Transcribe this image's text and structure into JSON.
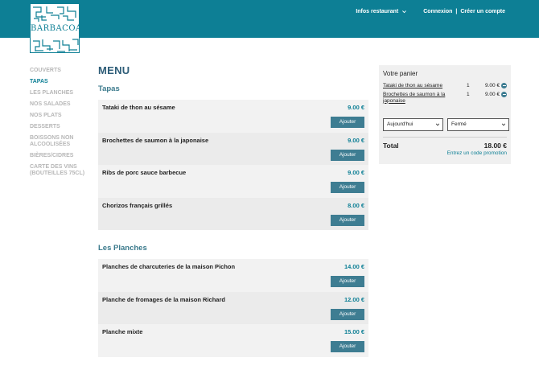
{
  "header": {
    "logo_text": "BARBACOA",
    "nav_info": "Infos restaurant",
    "login": "Connexion",
    "separator": "|",
    "signup": "Créer un compte"
  },
  "sidebar": {
    "items": [
      {
        "label": "COUVERTS",
        "active": false
      },
      {
        "label": "TAPAS",
        "active": true
      },
      {
        "label": "LES PLANCHES",
        "active": false
      },
      {
        "label": "NOS SALADES",
        "active": false
      },
      {
        "label": "NOS PLATS",
        "active": false
      },
      {
        "label": "DESSERTS",
        "active": false
      },
      {
        "label": "BOISSONS NON ALCOOLISÉES",
        "active": false
      },
      {
        "label": "BIÈRES/CIDRES",
        "active": false
      },
      {
        "label": "CARTE DES VINS (BOUTEILLES 75CL)",
        "active": false
      }
    ]
  },
  "main": {
    "title": "MENU",
    "add_label": "Ajouter",
    "sections": [
      {
        "title": "Tapas",
        "items": [
          {
            "name": "Tataki de thon au sésame",
            "price": "9.00 €"
          },
          {
            "name": "Brochettes de saumon à la japonaise",
            "price": "9.00 €"
          },
          {
            "name": "Ribs de porc sauce barbecue",
            "price": "9.00 €"
          },
          {
            "name": "Chorizos français grillés",
            "price": "8.00 €"
          }
        ]
      },
      {
        "title": "Les Planches",
        "items": [
          {
            "name": "Planches de charcuteries de la maison Pichon",
            "price": "14.00 €"
          },
          {
            "name": "Planche de fromages de la maison Richard",
            "price": "12.00 €"
          },
          {
            "name": "Planche mixte",
            "price": "15.00 €"
          }
        ]
      }
    ]
  },
  "cart": {
    "title": "Votre panier",
    "lines": [
      {
        "name": "Tataki de thon au sésame",
        "qty": "1",
        "price": "9.00 €"
      },
      {
        "name": "Brochettes de saumon à la japonaise",
        "qty": "1",
        "price": "9.00 €"
      }
    ],
    "day_select": "Aujourd'hui",
    "time_select": "Fermé",
    "total_label": "Total",
    "total_value": "18.00 €",
    "promo_link": "Entrez un code promotion"
  },
  "colors": {
    "brand": "#0d7f95",
    "button": "#3e7d92",
    "sidebar_inactive": "#b7b7b7"
  },
  "icons": {
    "nav_dropdown": "chevron-down-icon",
    "remove_line": "minus-circle-icon",
    "select_caret": "chevron-down-icon"
  }
}
